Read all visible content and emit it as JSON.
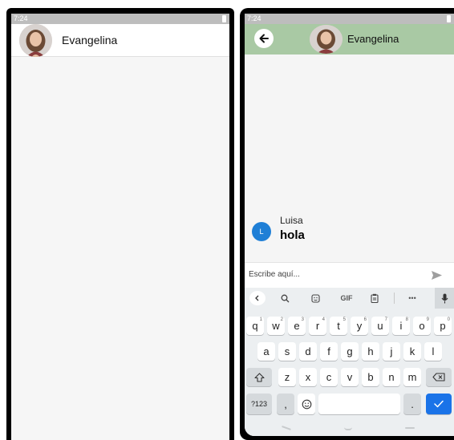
{
  "left_phone": {
    "status_time": "7:24",
    "contact_name": "Evangelina"
  },
  "right_phone": {
    "status_time": "7:24",
    "contact_name": "Evangelina",
    "message": {
      "avatar_initial": "L",
      "sender": "Luisa",
      "text": "hola"
    },
    "composer": {
      "placeholder": "Escribe aquí..."
    },
    "keyboard": {
      "toolbar": {
        "gif_label": "GIF",
        "more_label": "•••"
      },
      "row1": [
        {
          "key": "q",
          "hint": "1"
        },
        {
          "key": "w",
          "hint": "2"
        },
        {
          "key": "e",
          "hint": "3"
        },
        {
          "key": "r",
          "hint": "4"
        },
        {
          "key": "t",
          "hint": "5"
        },
        {
          "key": "y",
          "hint": "6"
        },
        {
          "key": "u",
          "hint": "7"
        },
        {
          "key": "i",
          "hint": "8"
        },
        {
          "key": "o",
          "hint": "9"
        },
        {
          "key": "p",
          "hint": "0"
        }
      ],
      "row2": [
        "a",
        "s",
        "d",
        "f",
        "g",
        "h",
        "j",
        "k",
        "l"
      ],
      "row3": [
        "z",
        "x",
        "c",
        "v",
        "b",
        "n",
        "m"
      ],
      "symbols_label": "?123",
      "comma_label": ",",
      "period_label": "."
    }
  },
  "colors": {
    "header_green": "#a9c9a4",
    "avatar_blue": "#1f7fd6",
    "enter_blue": "#1a73e8"
  }
}
